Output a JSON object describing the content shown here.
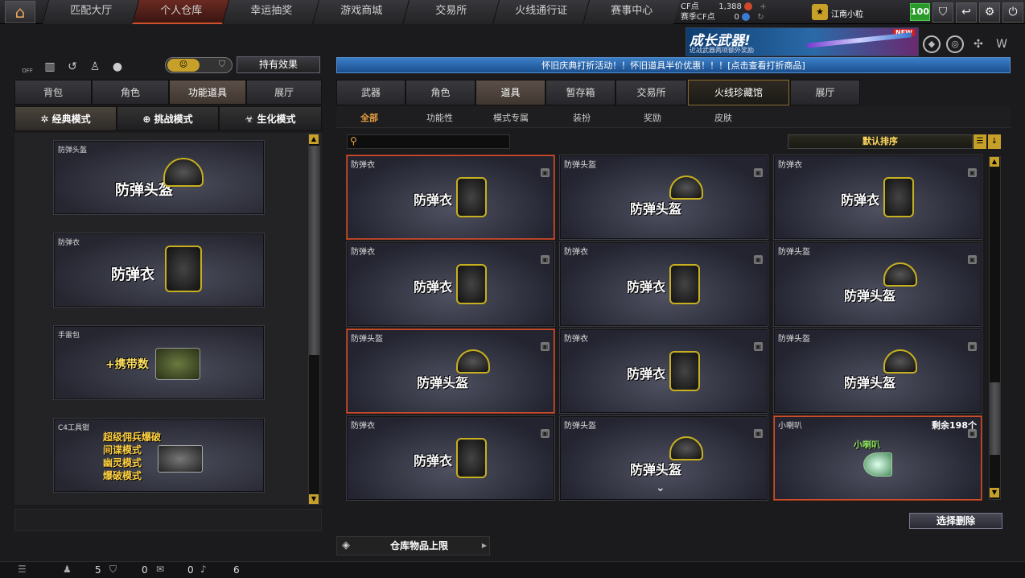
{
  "nav": {
    "tabs": [
      "匹配大厅",
      "个人仓库",
      "幸运抽奖",
      "游戏商城",
      "交易所",
      "火线通行证",
      "赛事中心"
    ],
    "active_index": 1
  },
  "currency": {
    "cf_label": "CF点",
    "cf_value": "1,388",
    "event_cf_label": "赛季CF点",
    "event_cf_value": "0"
  },
  "user": {
    "name": "江南小粒",
    "level": "100"
  },
  "banner": {
    "title": "成长武器!",
    "subtitle": "近战武器两项额外奖励",
    "badge": "NEW"
  },
  "announcement": "怀旧庆典打折活动！！怀旧道具半价优惠！！！[点击查看打折商品]",
  "left": {
    "toolbar_off_label": "OFF",
    "effect_button": "持有效果",
    "tabs": [
      "背包",
      "角色",
      "功能道具",
      "展厅"
    ],
    "active_tab": 2,
    "modes": [
      "经典模式",
      "挑战模式",
      "生化模式"
    ],
    "active_mode": 0,
    "cards": [
      {
        "name": "防弹头盔",
        "big": "防弹头盔"
      },
      {
        "name": "防弹衣",
        "big": "防弹衣"
      },
      {
        "name": "手雷包",
        "big": "+携带数"
      },
      {
        "name": "C4工具钳",
        "lines": [
          "超级佣兵爆破",
          "间谍模式",
          "幽灵模式",
          "爆破模式"
        ]
      }
    ]
  },
  "right": {
    "tabs": [
      "武器",
      "角色",
      "道具",
      "暂存箱",
      "交易所",
      "火线珍藏馆",
      "展厅"
    ],
    "active_tab": 2,
    "subtabs": [
      "全部",
      "功能性",
      "模式专属",
      "装扮",
      "奖励",
      "皮肤"
    ],
    "active_subtab": 0,
    "search_placeholder": "",
    "sort_label": "默认排序",
    "items": [
      {
        "name": "防弹衣",
        "big": "防弹衣"
      },
      {
        "name": "防弹头盔",
        "big": "防弹头盔"
      },
      {
        "name": "防弹衣",
        "big": "防弹衣"
      },
      {
        "name": "防弹衣",
        "big": "防弹衣"
      },
      {
        "name": "防弹衣",
        "big": "防弹衣"
      },
      {
        "name": "防弹头盔",
        "big": "防弹头盔"
      },
      {
        "name": "防弹头盔",
        "big": "防弹头盔"
      },
      {
        "name": "防弹衣",
        "big": "防弹衣"
      },
      {
        "name": "防弹头盔",
        "big": "防弹头盔"
      },
      {
        "name": "防弹衣",
        "big": "防弹衣"
      },
      {
        "name": "防弹头盔",
        "big": "防弹头盔"
      },
      {
        "name": "小喇叭",
        "big": "小喇叭",
        "count": "剩余198个"
      }
    ],
    "delete_button": "选择删除",
    "capacity_label": "仓库物品上限"
  },
  "statusbar": {
    "friends": "5",
    "shield": "0",
    "chat": "0",
    "volume": "6"
  }
}
